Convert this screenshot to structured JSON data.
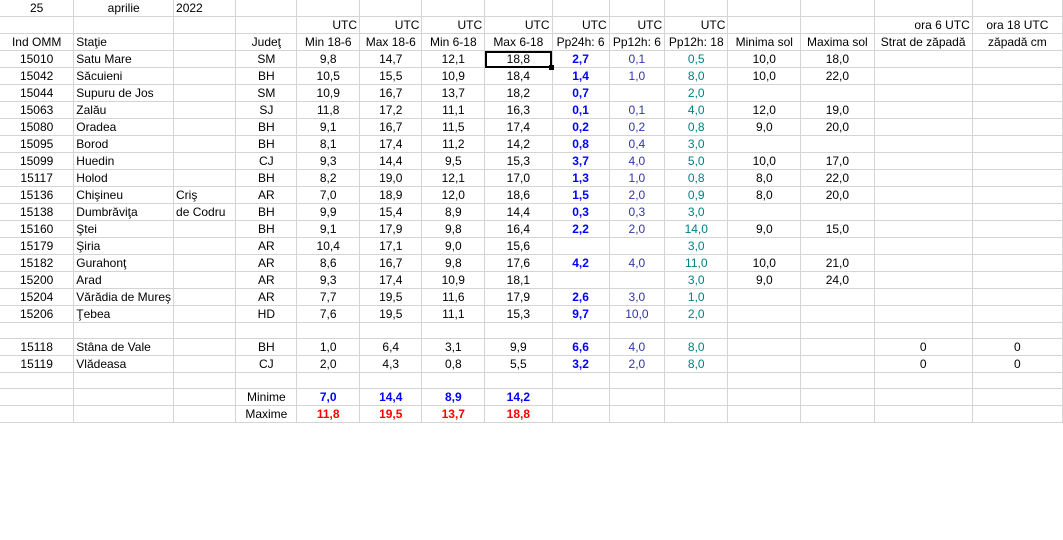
{
  "title_row": {
    "day": "25",
    "month": "aprilie",
    "year": "2022"
  },
  "unit_row": [
    "UTC",
    "UTC",
    "UTC",
    "UTC",
    "UTC",
    "UTC",
    "UTC",
    "ora 6 UTC",
    "ora 18 UTC"
  ],
  "headers": [
    "Ind OMM",
    "Staţie",
    "",
    "Judeţ",
    "Min 18-6",
    "Max 18-6",
    "Min 6-18",
    "Max 6-18",
    "Pp24h: 6",
    "Pp12h: 6",
    "Pp12h: 18",
    "Minima sol",
    "Maxima sol",
    "Strat de zăpadă",
    "zăpadă cm"
  ],
  "rows": [
    [
      "15010",
      "Satu Mare",
      "",
      "SM",
      "9,8",
      "14,7",
      "12,1",
      "18,8",
      "2,7",
      "0,1",
      "0,5",
      "10,0",
      "18,0",
      "",
      ""
    ],
    [
      "15042",
      "Săcuieni",
      "",
      "BH",
      "10,5",
      "15,5",
      "10,9",
      "18,4",
      "1,4",
      "1,0",
      "8,0",
      "10,0",
      "22,0",
      "",
      ""
    ],
    [
      "15044",
      "Supuru de Jos",
      "",
      "SM",
      "10,9",
      "16,7",
      "13,7",
      "18,2",
      "0,7",
      "",
      "2,0",
      "",
      "",
      "",
      ""
    ],
    [
      "15063",
      "Zalău",
      "",
      "SJ",
      "11,8",
      "17,2",
      "11,1",
      "16,3",
      "0,1",
      "0,1",
      "4,0",
      "12,0",
      "19,0",
      "",
      ""
    ],
    [
      "15080",
      "Oradea",
      "",
      "BH",
      "9,1",
      "16,7",
      "11,5",
      "17,4",
      "0,2",
      "0,2",
      "0,8",
      "9,0",
      "20,0",
      "",
      ""
    ],
    [
      "15095",
      "Borod",
      "",
      "BH",
      "8,1",
      "17,4",
      "11,2",
      "14,2",
      "0,8",
      "0,4",
      "3,0",
      "",
      "",
      "",
      ""
    ],
    [
      "15099",
      "Huedin",
      "",
      "CJ",
      "9,3",
      "14,4",
      "9,5",
      "15,3",
      "3,7",
      "4,0",
      "5,0",
      "10,0",
      "17,0",
      "",
      ""
    ],
    [
      "15117",
      "Holod",
      "",
      "BH",
      "8,2",
      "19,0",
      "12,1",
      "17,0",
      "1,3",
      "1,0",
      "0,8",
      "8,0",
      "22,0",
      "",
      ""
    ],
    [
      "15136",
      "Chişineu",
      "Criş",
      "AR",
      "7,0",
      "18,9",
      "12,0",
      "18,6",
      "1,5",
      "2,0",
      "0,9",
      "8,0",
      "20,0",
      "",
      ""
    ],
    [
      "15138",
      "Dumbrăviţa",
      "de Codru",
      "BH",
      "9,9",
      "15,4",
      "8,9",
      "14,4",
      "0,3",
      "0,3",
      "3,0",
      "",
      "",
      "",
      ""
    ],
    [
      "15160",
      "Ştei",
      "",
      "BH",
      "9,1",
      "17,9",
      "9,8",
      "16,4",
      "2,2",
      "2,0",
      "14,0",
      "9,0",
      "15,0",
      "",
      ""
    ],
    [
      "15179",
      "Şiria",
      "",
      "AR",
      "10,4",
      "17,1",
      "9,0",
      "15,6",
      "",
      "",
      "3,0",
      "",
      "",
      "",
      ""
    ],
    [
      "15182",
      "Gurahonţ",
      "",
      "AR",
      "8,6",
      "16,7",
      "9,8",
      "17,6",
      "4,2",
      "4,0",
      "11,0",
      "10,0",
      "21,0",
      "",
      ""
    ],
    [
      "15200",
      "Arad",
      "",
      "AR",
      "9,3",
      "17,4",
      "10,9",
      "18,1",
      "",
      "",
      "3,0",
      "9,0",
      "24,0",
      "",
      ""
    ],
    [
      "15204",
      "Vărădia de Mureş",
      "",
      "AR",
      "7,7",
      "19,5",
      "11,6",
      "17,9",
      "2,6",
      "3,0",
      "1,0",
      "",
      "",
      "",
      ""
    ],
    [
      "15206",
      "Ţebea",
      "",
      "HD",
      "7,6",
      "19,5",
      "11,1",
      "15,3",
      "9,7",
      "10,0",
      "2,0",
      "",
      "",
      "",
      ""
    ],
    [
      "",
      "",
      "",
      "",
      "",
      "",
      "",
      "",
      "",
      "",
      "",
      "",
      "",
      "",
      ""
    ],
    [
      "15118",
      "Stâna de Vale",
      "",
      "BH",
      "1,0",
      "6,4",
      "3,1",
      "9,9",
      "6,6",
      "4,0",
      "8,0",
      "",
      "",
      "0",
      "0"
    ],
    [
      "15119",
      "Vlădeasa",
      "",
      "CJ",
      "2,0",
      "4,3",
      "0,8",
      "5,5",
      "3,2",
      "2,0",
      "8,0",
      "",
      "",
      "0",
      "0"
    ]
  ],
  "summary": {
    "min_label": "Minime",
    "min": [
      "7,0",
      "14,4",
      "8,9",
      "14,2"
    ],
    "max_label": "Maxime",
    "max": [
      "11,8",
      "19,5",
      "13,7",
      "18,8"
    ]
  },
  "colors": {
    "grid": "#d4d4d4",
    "precip24": "#0000ff",
    "precip12_6": "#3333aa",
    "precip12_18": "#008080",
    "max_values": "#ff0000",
    "min_values": "#0000ff"
  }
}
